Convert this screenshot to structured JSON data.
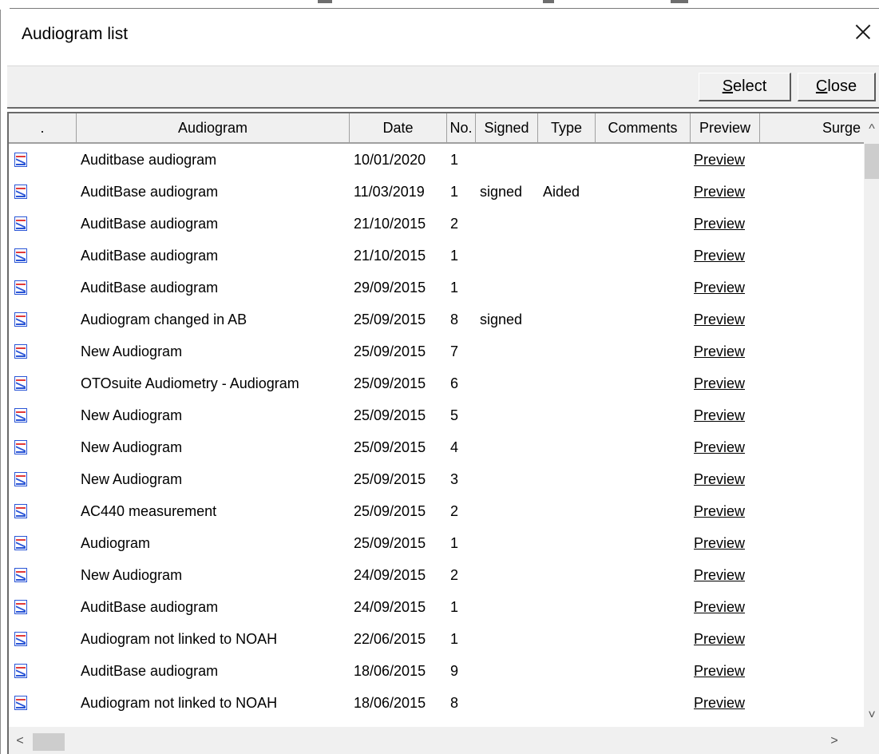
{
  "window": {
    "title": "Audiogram list"
  },
  "toolbar": {
    "select_prefix": "",
    "select_mnemonic": "S",
    "select_rest": "elect",
    "close_prefix": "",
    "close_mnemonic": "C",
    "close_rest": "lose"
  },
  "columns": [
    ".",
    "Audiogram",
    "Date",
    "No.",
    "Signed",
    "Type",
    "Comments",
    "Preview",
    "Surge"
  ],
  "row_icon": "audiogram-chart-icon",
  "rows": [
    {
      "audiogram": "Auditbase audiogram",
      "date": "10/01/2020",
      "no": "1",
      "signed": "",
      "type": "",
      "comments": "",
      "preview": "Preview"
    },
    {
      "audiogram": "AuditBase audiogram",
      "date": "11/03/2019",
      "no": "1",
      "signed": "signed",
      "type": "Aided",
      "comments": "",
      "preview": "Preview"
    },
    {
      "audiogram": "AuditBase audiogram",
      "date": "21/10/2015",
      "no": "2",
      "signed": "",
      "type": "",
      "comments": "",
      "preview": "Preview"
    },
    {
      "audiogram": "AuditBase audiogram",
      "date": "21/10/2015",
      "no": "1",
      "signed": "",
      "type": "",
      "comments": "",
      "preview": "Preview"
    },
    {
      "audiogram": "AuditBase audiogram",
      "date": "29/09/2015",
      "no": "1",
      "signed": "",
      "type": "",
      "comments": "",
      "preview": "Preview"
    },
    {
      "audiogram": "Audiogram changed in AB",
      "date": "25/09/2015",
      "no": "8",
      "signed": "signed",
      "type": "",
      "comments": "",
      "preview": "Preview"
    },
    {
      "audiogram": "New Audiogram",
      "date": "25/09/2015",
      "no": "7",
      "signed": "",
      "type": "",
      "comments": "",
      "preview": "Preview"
    },
    {
      "audiogram": "OTOsuite Audiometry - Audiogram",
      "date": "25/09/2015",
      "no": "6",
      "signed": "",
      "type": "",
      "comments": "",
      "preview": "Preview"
    },
    {
      "audiogram": "New Audiogram",
      "date": "25/09/2015",
      "no": "5",
      "signed": "",
      "type": "",
      "comments": "",
      "preview": "Preview"
    },
    {
      "audiogram": "New Audiogram",
      "date": "25/09/2015",
      "no": "4",
      "signed": "",
      "type": "",
      "comments": "",
      "preview": "Preview"
    },
    {
      "audiogram": "New Audiogram",
      "date": "25/09/2015",
      "no": "3",
      "signed": "",
      "type": "",
      "comments": "",
      "preview": "Preview"
    },
    {
      "audiogram": "AC440 measurement",
      "date": "25/09/2015",
      "no": "2",
      "signed": "",
      "type": "",
      "comments": "",
      "preview": "Preview"
    },
    {
      "audiogram": "Audiogram",
      "date": "25/09/2015",
      "no": "1",
      "signed": "",
      "type": "",
      "comments": "",
      "preview": "Preview"
    },
    {
      "audiogram": "New Audiogram",
      "date": "24/09/2015",
      "no": "2",
      "signed": "",
      "type": "",
      "comments": "",
      "preview": "Preview"
    },
    {
      "audiogram": "AuditBase audiogram",
      "date": "24/09/2015",
      "no": "1",
      "signed": "",
      "type": "",
      "comments": "",
      "preview": "Preview"
    },
    {
      "audiogram": "Audiogram not linked to NOAH",
      "date": "22/06/2015",
      "no": "1",
      "signed": "",
      "type": "",
      "comments": "",
      "preview": "Preview"
    },
    {
      "audiogram": "AuditBase audiogram",
      "date": "18/06/2015",
      "no": "9",
      "signed": "",
      "type": "",
      "comments": "",
      "preview": "Preview"
    },
    {
      "audiogram": "Audiogram not linked to NOAH",
      "date": "18/06/2015",
      "no": "8",
      "signed": "",
      "type": "",
      "comments": "",
      "preview": "Preview"
    }
  ],
  "scroll": {
    "up_glyph": "^",
    "down_glyph": "˅",
    "left_glyph": "<",
    "right_glyph": ">"
  }
}
